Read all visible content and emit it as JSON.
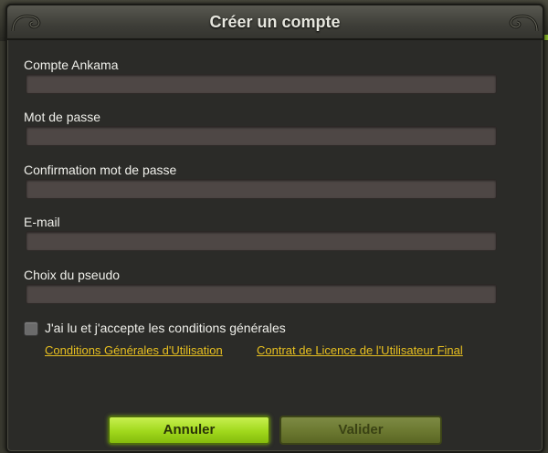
{
  "window": {
    "title": "Créer un compte"
  },
  "form": {
    "fields": [
      {
        "label": "Compte Ankama",
        "value": ""
      },
      {
        "label": "Mot de passe",
        "value": ""
      },
      {
        "label": "Confirmation mot de passe",
        "value": ""
      },
      {
        "label": "E-mail",
        "value": ""
      },
      {
        "label": "Choix du pseudo",
        "value": ""
      }
    ],
    "accept_checkbox": {
      "label": "J'ai lu et j'accepte les conditions générales",
      "checked": false
    },
    "links": {
      "cgu": "Conditions Générales d'Utilisation",
      "eula": "Contrat de Licence de l'Utilisateur Final"
    }
  },
  "buttons": {
    "cancel": "Annuler",
    "validate": "Valider"
  },
  "colors": {
    "accent_green": "#a0d81c",
    "link_yellow": "#e8c020",
    "panel_bg": "#2b2b28"
  }
}
